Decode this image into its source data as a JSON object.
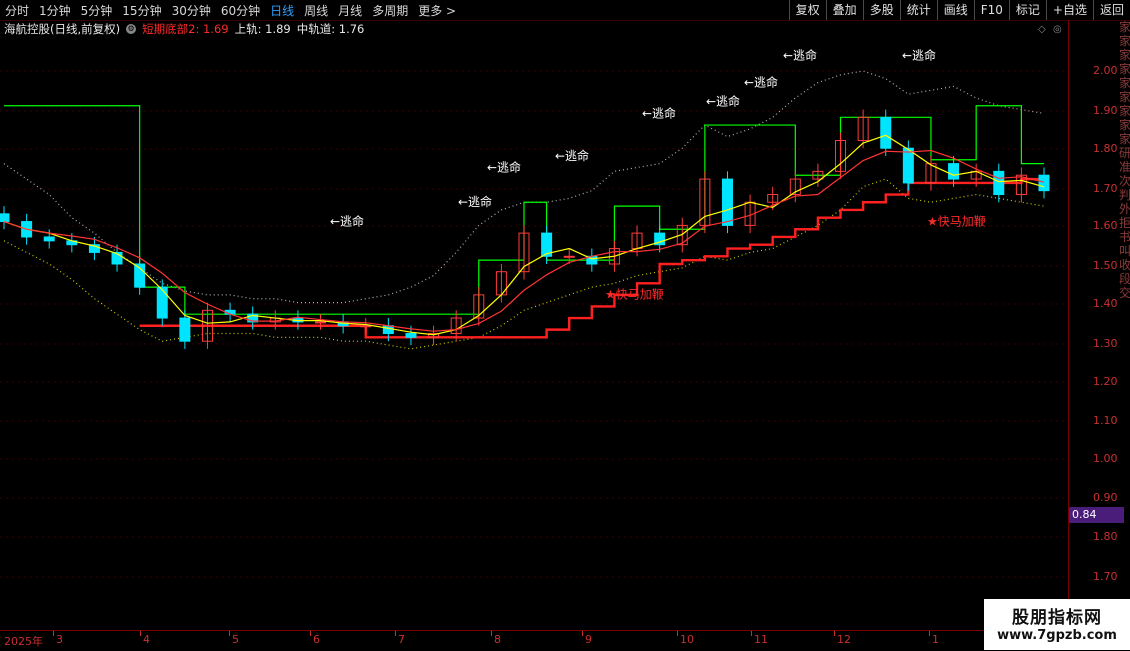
{
  "toolbar": {
    "timeframes": [
      "分时",
      "1分钟",
      "5分钟",
      "15分钟",
      "30分钟",
      "60分钟",
      "日线",
      "周线",
      "月线",
      "多周期",
      "更多 >"
    ],
    "active": "日线",
    "right_buttons": [
      "复权",
      "叠加",
      "多股",
      "统计",
      "画线",
      "F10",
      "标记",
      "+自选",
      "返回"
    ]
  },
  "info": {
    "title": "海航控股(日线,前复权)",
    "indicator": "短期底部2: 1.69",
    "upper": "上轨: 1.89",
    "middle": "中轨道: 1.76"
  },
  "axis": {
    "ticks": [
      "2.00",
      "1.90",
      "1.80",
      "1.70",
      "1.60",
      "1.50",
      "1.40",
      "1.30",
      "1.20",
      "1.10",
      "1.00",
      "0.90",
      "1.80",
      "1.70"
    ],
    "current": "0.84"
  },
  "xaxis": {
    "labels": [
      "2025年",
      "3",
      "4",
      "5",
      "6",
      "7",
      "8",
      "9",
      "10",
      "11",
      "12",
      "1"
    ]
  },
  "right_strip": "家家家家家家家家家研准次判外拒书叫收段交",
  "watermark": {
    "line1": "股朋指标网",
    "line2": "www.7gpzb.com"
  },
  "colors": {
    "up": "#ff3c3c",
    "down": "#00e5ff",
    "upper_band": "#ffffff",
    "lower_band": "#ffff00",
    "step_green": "#00ff00",
    "step_red": "#ff2020",
    "ma": "#ffff00",
    "ma2": "#ff3333"
  },
  "chart_data": {
    "type": "candlestick",
    "ylim": [
      0.65,
      2.07
    ],
    "annotations": [
      {
        "text": "←逃命",
        "month": "5-6",
        "y": 1.6
      },
      {
        "text": "←逃命",
        "month": "7-8",
        "y": 1.65
      },
      {
        "text": "←逃命",
        "month": "8",
        "y": 1.74
      },
      {
        "text": "←逃命",
        "month": "9",
        "y": 1.77
      },
      {
        "text": "←逃命",
        "month": "9-10",
        "y": 1.88
      },
      {
        "text": "←逃命",
        "month": "10",
        "y": 1.91
      },
      {
        "text": "←逃命",
        "month": "11",
        "y": 1.96
      },
      {
        "text": "←逃命",
        "month": "11",
        "y": 2.03
      },
      {
        "text": "←逃命",
        "month": "12",
        "y": 2.03
      },
      {
        "text": "★快马加鞭",
        "month": "8-9",
        "y": 1.41
      },
      {
        "text": "★快马加鞭",
        "month": "12-1",
        "y": 1.6
      }
    ],
    "series": [
      {
        "name": "close",
        "values": [
          1.61,
          1.57,
          1.56,
          1.55,
          1.53,
          1.5,
          1.44,
          1.36,
          1.3,
          1.38,
          1.37,
          1.35,
          1.36,
          1.35,
          1.35,
          1.34,
          1.34,
          1.32,
          1.31,
          1.32,
          1.36,
          1.42,
          1.48,
          1.58,
          1.52,
          1.52,
          1.5,
          1.54,
          1.58,
          1.55,
          1.6,
          1.72,
          1.6,
          1.66,
          1.68,
          1.72,
          1.74,
          1.82,
          1.88,
          1.8,
          1.71,
          1.76,
          1.72,
          1.74,
          1.68,
          1.73,
          1.69
        ]
      },
      {
        "name": "upper band",
        "values": [
          1.76,
          1.72,
          1.68,
          1.62,
          1.58,
          1.53,
          1.49,
          1.45,
          1.43,
          1.42,
          1.42,
          1.41,
          1.41,
          1.4,
          1.4,
          1.4,
          1.41,
          1.42,
          1.44,
          1.47,
          1.53,
          1.6,
          1.64,
          1.66,
          1.66,
          1.67,
          1.69,
          1.74,
          1.75,
          1.76,
          1.8,
          1.86,
          1.83,
          1.85,
          1.88,
          1.93,
          1.97,
          1.99,
          2.0,
          1.98,
          1.94,
          1.95,
          1.96,
          1.93,
          1.91,
          1.9,
          1.89
        ]
      },
      {
        "name": "lower band",
        "values": [
          1.56,
          1.53,
          1.5,
          1.46,
          1.41,
          1.37,
          1.33,
          1.3,
          1.31,
          1.32,
          1.32,
          1.32,
          1.31,
          1.31,
          1.31,
          1.3,
          1.3,
          1.29,
          1.28,
          1.29,
          1.3,
          1.31,
          1.34,
          1.38,
          1.4,
          1.42,
          1.44,
          1.45,
          1.47,
          1.48,
          1.49,
          1.52,
          1.51,
          1.53,
          1.54,
          1.57,
          1.6,
          1.64,
          1.7,
          1.72,
          1.67,
          1.66,
          1.67,
          1.68,
          1.67,
          1.66,
          1.65
        ]
      },
      {
        "name": "step green",
        "values": [
          1.91,
          1.91,
          1.91,
          1.91,
          1.91,
          1.91,
          1.44,
          1.44,
          1.37,
          1.37,
          1.37,
          1.37,
          1.37,
          1.37,
          1.37,
          1.37,
          1.37,
          1.37,
          1.37,
          1.37,
          1.37,
          1.51,
          1.51,
          1.66,
          1.51,
          1.51,
          1.51,
          1.65,
          1.65,
          1.59,
          1.59,
          1.86,
          1.86,
          1.86,
          1.86,
          1.73,
          1.73,
          1.88,
          1.88,
          1.88,
          1.88,
          1.77,
          1.77,
          1.91,
          1.91,
          1.76,
          1.76
        ]
      },
      {
        "name": "step red",
        "values": [
          null,
          null,
          null,
          null,
          null,
          null,
          1.34,
          1.34,
          1.34,
          1.34,
          1.34,
          1.34,
          1.34,
          1.34,
          1.34,
          1.34,
          1.31,
          1.31,
          1.31,
          1.31,
          1.31,
          1.31,
          1.31,
          1.31,
          1.33,
          1.36,
          1.39,
          1.42,
          1.45,
          1.5,
          1.51,
          1.52,
          1.54,
          1.55,
          1.57,
          1.59,
          1.62,
          1.64,
          1.66,
          1.68,
          1.71,
          1.71,
          1.71,
          1.71,
          1.71,
          1.72,
          1.72
        ]
      }
    ]
  }
}
